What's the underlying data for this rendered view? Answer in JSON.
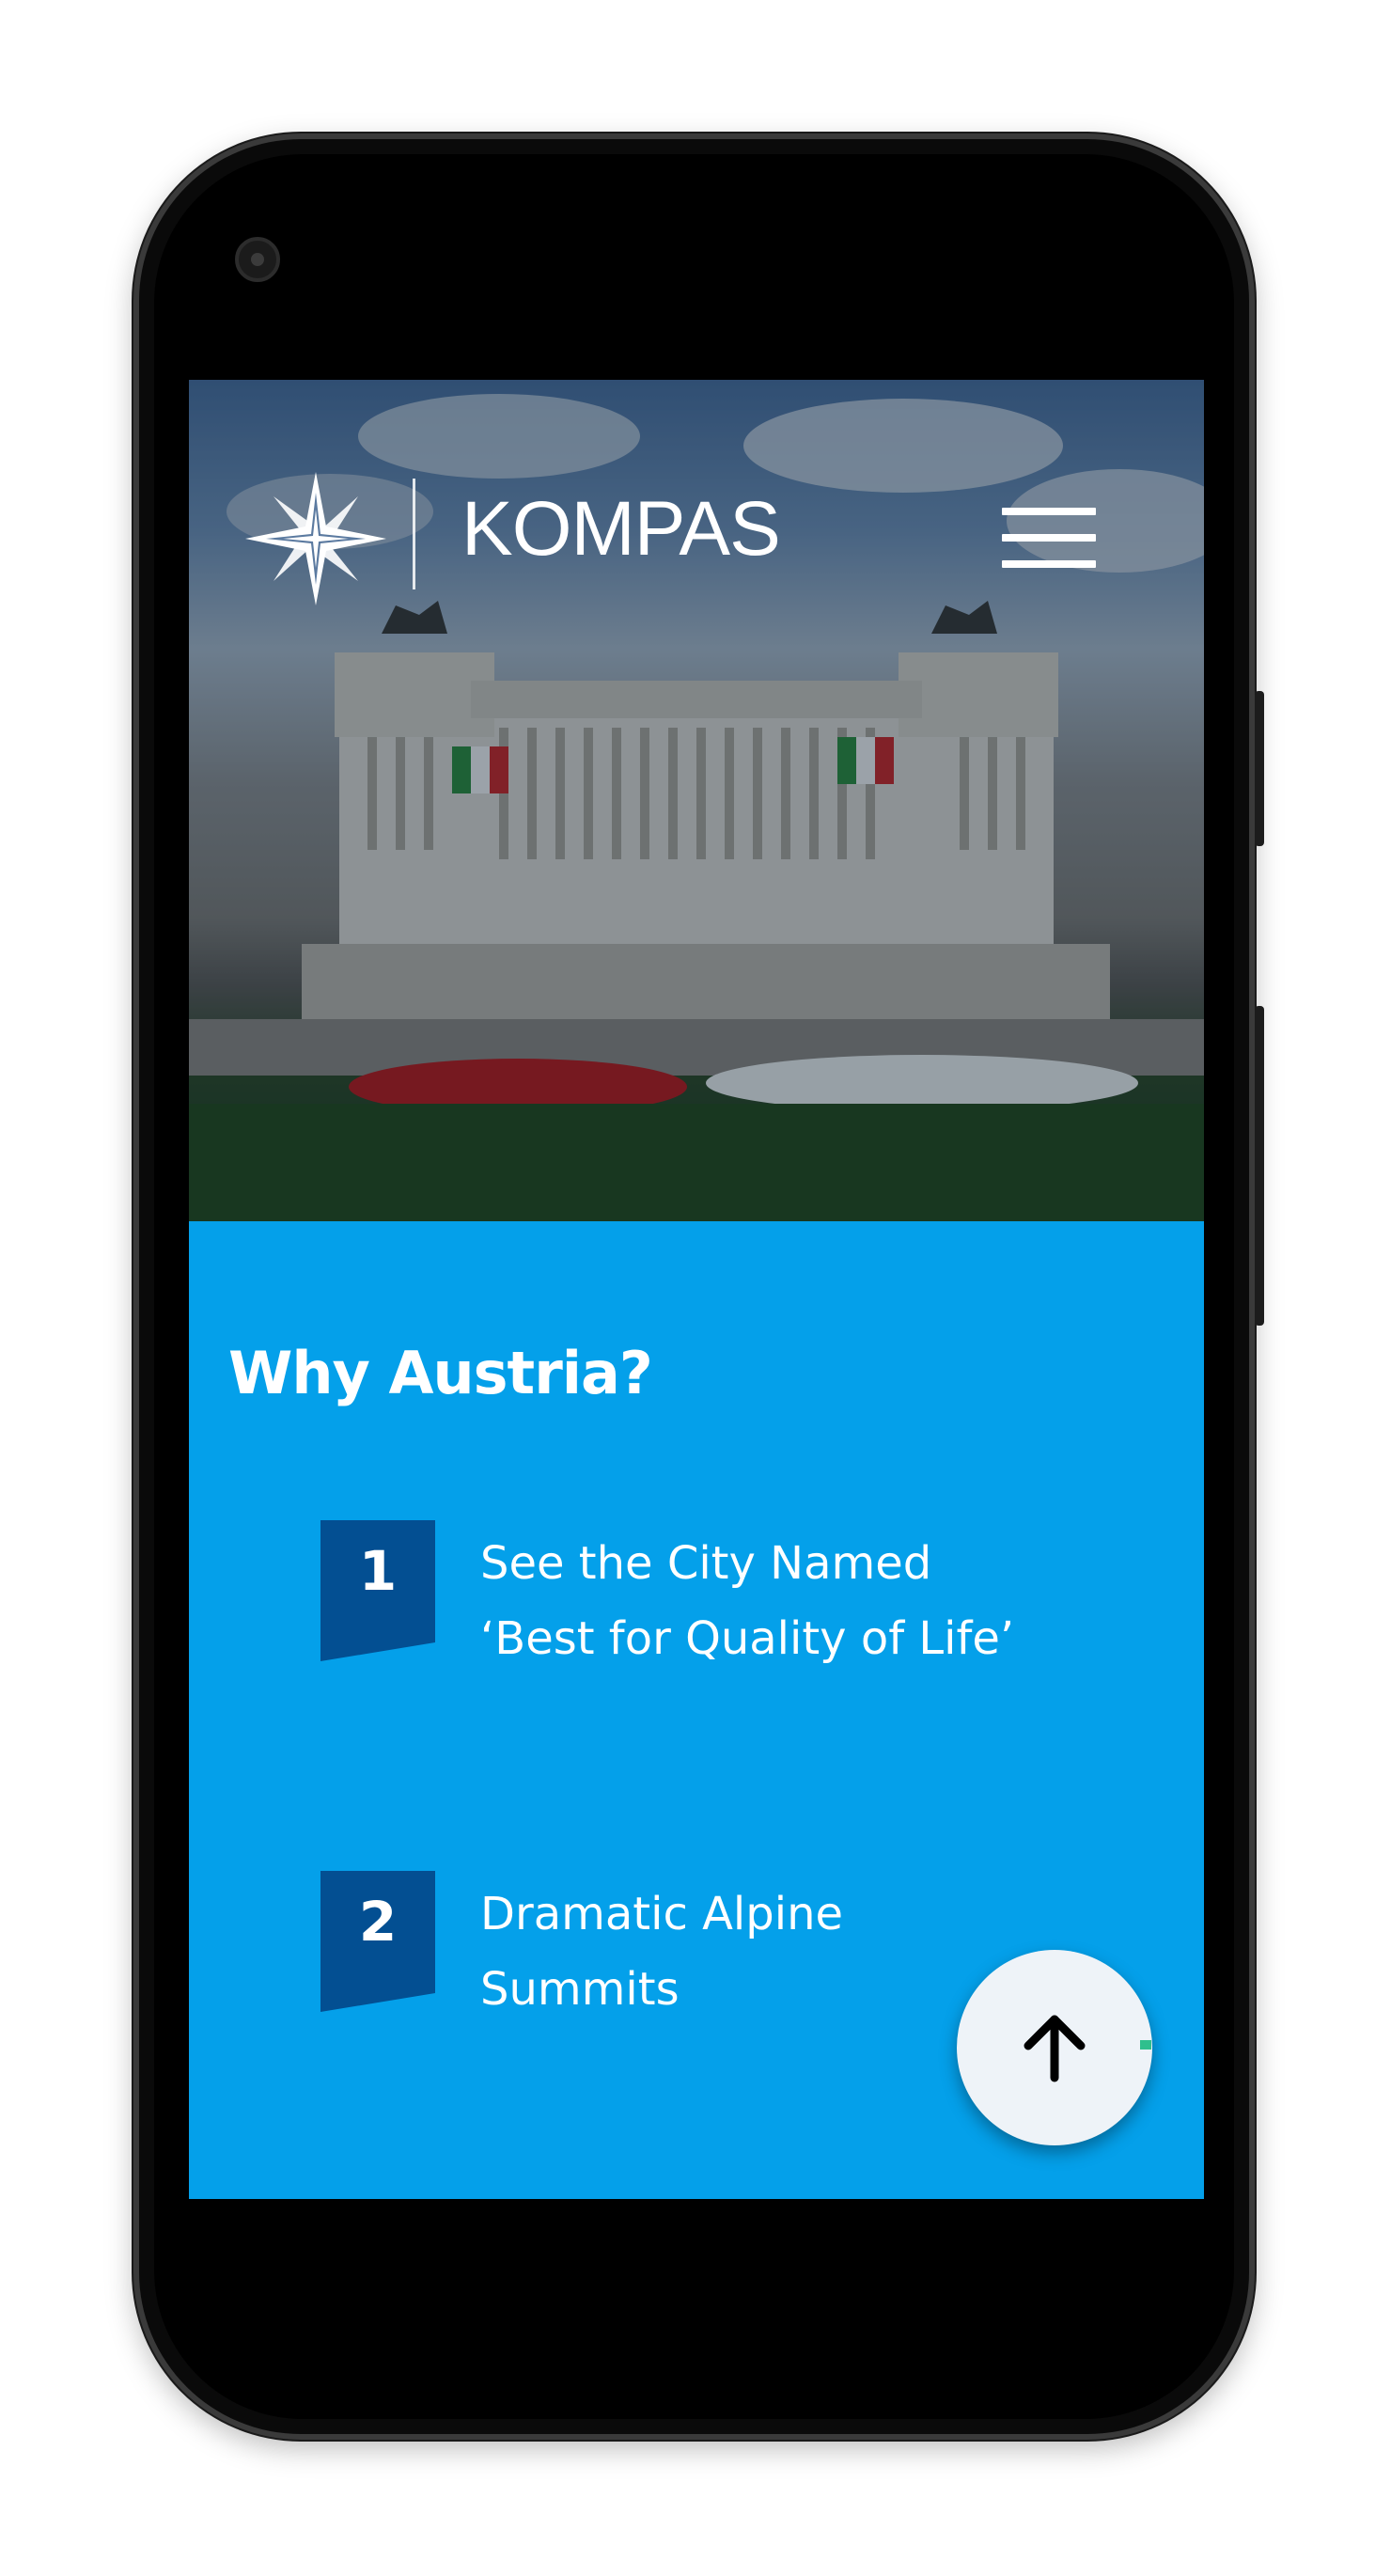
{
  "header": {
    "brand": "KOMPAS",
    "logo_icon": "compass-star-icon",
    "menu_icon": "hamburger-menu-icon"
  },
  "hero": {
    "image_icon": "monument-photo"
  },
  "why_section": {
    "title": "Why Austria?",
    "items": [
      {
        "number": "1",
        "text": "See the City Named\n‘Best for Quality of Life’"
      },
      {
        "number": "2",
        "text": "Dramatic Alpine\nSummits"
      }
    ]
  },
  "scroll_top_button": {
    "icon": "arrow-up-icon"
  },
  "colors": {
    "section_bg": "#04a0ea",
    "badge": "#034f92",
    "fab_bg": "#eef3f8"
  }
}
